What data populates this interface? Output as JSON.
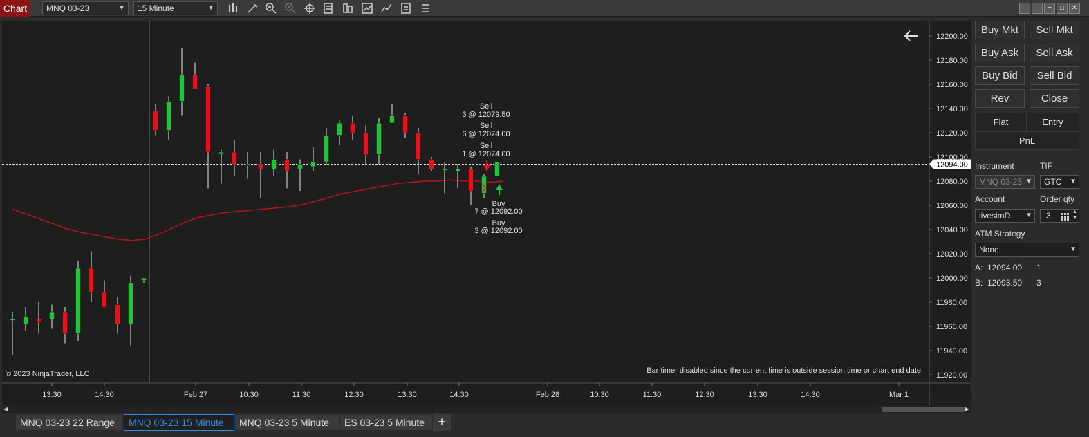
{
  "toolbar": {
    "chart_tab": "Chart",
    "instrument": "MNQ 03-23",
    "interval": "15 Minute",
    "icons": [
      "bars-type-icon",
      "draw-pen-icon",
      "zoom-in-icon",
      "zoom-out-icon",
      "crosshair-icon",
      "properties-icon",
      "data-series-icon",
      "strategies-icon",
      "indicators-icon",
      "templates-icon",
      "chart-trader-icon"
    ]
  },
  "chart": {
    "copyright": "© 2023 NinjaTrader, LLC",
    "bar_timer": "Bar timer disabled since the current time is outside session time or chart end date",
    "current_price_label": "12094.00",
    "y_ticks": [
      "12200.00",
      "12180.00",
      "12160.00",
      "12140.00",
      "12120.00",
      "12100.00",
      "12080.00",
      "12060.00",
      "12040.00",
      "12020.00",
      "12000.00",
      "11980.00",
      "11960.00",
      "11940.00",
      "11920.00"
    ],
    "x_ticks": [
      "13:30",
      "14:30",
      "Feb 27",
      "10:30",
      "11:30",
      "12:30",
      "13:30",
      "14:30",
      "Feb 28",
      "10:30",
      "11:30",
      "12:30",
      "13:30",
      "14:30",
      "Mar 1"
    ],
    "annotations": {
      "sell1": {
        "type": "Sell",
        "qty": "3 @ 12079.50"
      },
      "sell2": {
        "type": "Sell",
        "qty": "6 @ 12074.00"
      },
      "sell3": {
        "type": "Sell",
        "qty": "1 @ 12074.00"
      },
      "buy1": {
        "type": "Buy",
        "qty": "7 @ 12092.00"
      },
      "buy2": {
        "type": "Buy",
        "qty": "3 @ 12092.00"
      }
    },
    "colors": {
      "up": "#22c33a",
      "down": "#e8111a",
      "ma": "#b3151b",
      "bg": "#1e1e1e"
    }
  },
  "chart_data": {
    "type": "candlestick",
    "instrument": "MNQ 03-23",
    "interval": "15 Minute",
    "ylim": [
      11910,
      12210
    ],
    "candles": [
      {
        "o": 11966,
        "h": 11972,
        "l": 11936,
        "c": 11966
      },
      {
        "o": 11962,
        "h": 11976,
        "l": 11956,
        "c": 11968
      },
      {
        "o": 11966,
        "h": 11980,
        "l": 11954,
        "c": 11964
      },
      {
        "o": 11966,
        "h": 11978,
        "l": 11958,
        "c": 11972
      },
      {
        "o": 11972,
        "h": 11976,
        "l": 11946,
        "c": 11954
      },
      {
        "o": 11954,
        "h": 12014,
        "l": 11948,
        "c": 12008
      },
      {
        "o": 12008,
        "h": 12022,
        "l": 11980,
        "c": 11988
      },
      {
        "o": 11988,
        "h": 11998,
        "l": 11976,
        "c": 11976
      },
      {
        "o": 11978,
        "h": 11984,
        "l": 11954,
        "c": 11962
      },
      {
        "o": 11962,
        "h": 12002,
        "l": 11944,
        "c": 11996
      },
      {
        "o": 11998,
        "h": 12000,
        "l": 11996,
        "c": 12000
      },
      {
        "o": 12138,
        "h": 12144,
        "l": 12118,
        "c": 12122
      },
      {
        "o": 12122,
        "h": 12150,
        "l": 12114,
        "c": 12146
      },
      {
        "o": 12146,
        "h": 12190,
        "l": 12134,
        "c": 12168
      },
      {
        "o": 12168,
        "h": 12178,
        "l": 12156,
        "c": 12156
      },
      {
        "o": 12158,
        "h": 12160,
        "l": 12074,
        "c": 12104
      },
      {
        "o": 12104,
        "h": 12106,
        "l": 12078,
        "c": 12104
      },
      {
        "o": 12104,
        "h": 12114,
        "l": 12084,
        "c": 12094
      },
      {
        "o": 12094,
        "h": 12104,
        "l": 12082,
        "c": 12094
      },
      {
        "o": 12094,
        "h": 12104,
        "l": 12066,
        "c": 12090
      },
      {
        "o": 12090,
        "h": 12106,
        "l": 12084,
        "c": 12098
      },
      {
        "o": 12098,
        "h": 12104,
        "l": 12074,
        "c": 12088
      },
      {
        "o": 12090,
        "h": 12098,
        "l": 12072,
        "c": 12094
      },
      {
        "o": 12092,
        "h": 12108,
        "l": 12088,
        "c": 12096
      },
      {
        "o": 12096,
        "h": 12124,
        "l": 12094,
        "c": 12118
      },
      {
        "o": 12118,
        "h": 12130,
        "l": 12110,
        "c": 12128
      },
      {
        "o": 12128,
        "h": 12134,
        "l": 12114,
        "c": 12120
      },
      {
        "o": 12120,
        "h": 12126,
        "l": 12094,
        "c": 12102
      },
      {
        "o": 12102,
        "h": 12132,
        "l": 12094,
        "c": 12128
      },
      {
        "o": 12128,
        "h": 12144,
        "l": 12128,
        "c": 12134
      },
      {
        "o": 12134,
        "h": 12136,
        "l": 12116,
        "c": 12120
      },
      {
        "o": 12120,
        "h": 12124,
        "l": 12086,
        "c": 12098
      },
      {
        "o": 12098,
        "h": 12100,
        "l": 12088,
        "c": 12090
      },
      {
        "o": 12090,
        "h": 12096,
        "l": 12070,
        "c": 12090
      },
      {
        "o": 12088,
        "h": 12094,
        "l": 12074,
        "c": 12090
      },
      {
        "o": 12090,
        "h": 12092,
        "l": 12060,
        "c": 12072
      },
      {
        "o": 12070,
        "h": 12086,
        "l": 12066,
        "c": 12084
      },
      {
        "o": 12084,
        "h": 12096,
        "l": 12084,
        "c": 12096
      }
    ],
    "moving_average": [
      12057,
      12053,
      12049,
      12045,
      12041,
      12038,
      12036,
      12034,
      12032,
      12031,
      12032,
      12036,
      12041,
      12046,
      12050,
      12052,
      12054,
      12055,
      12056,
      12057,
      12058,
      12059,
      12061,
      12064,
      12067,
      12070,
      12072,
      12074,
      12076,
      12078,
      12079,
      12080,
      12080,
      12081,
      12080,
      12080,
      12079,
      12080
    ],
    "current_price": 12094.0,
    "vertical_marker_index": 10
  },
  "panel": {
    "buttons": {
      "buy_mkt": "Buy Mkt",
      "sell_mkt": "Sell Mkt",
      "buy_ask": "Buy Ask",
      "sell_ask": "Sell Ask",
      "buy_bid": "Buy Bid",
      "sell_bid": "Sell Bid",
      "rev": "Rev",
      "close": "Close"
    },
    "flat": "Flat",
    "entry": "Entry",
    "pnl": "PnL",
    "instrument_label": "Instrument",
    "instrument_value": "MNQ 03-23",
    "tif_label": "TIF",
    "tif_value": "GTC",
    "account_label": "Account",
    "account_value": "livesimD...",
    "order_qty_label": "Order qty",
    "order_qty_value": "3",
    "atm_label": "ATM Strategy",
    "atm_value": "None",
    "ask_label": "A:",
    "ask_price": "12094.00",
    "ask_size": "1",
    "bid_label": "B:",
    "bid_price": "12093.50",
    "bid_size": "3"
  },
  "tabs": [
    "MNQ 03-23 22 Range",
    "MNQ 03-23 15 Minute",
    "MNQ 03-23 5 Minute",
    "ES 03-23 5 Minute"
  ],
  "active_tab": 1
}
